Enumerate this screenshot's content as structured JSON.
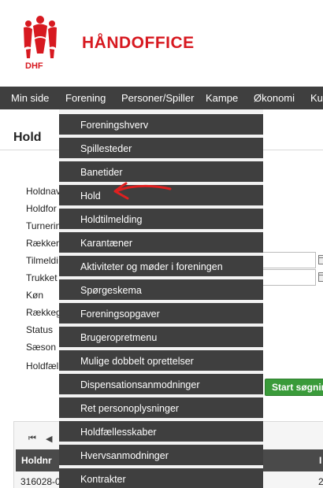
{
  "header": {
    "brand": "HÅNDOFFICE",
    "logo_caption": "DHF"
  },
  "nav": {
    "items": [
      {
        "label": "Min side"
      },
      {
        "label": "Forening"
      },
      {
        "label": "Personer/Spiller"
      },
      {
        "label": "Kampe"
      },
      {
        "label": "Økonomi"
      },
      {
        "label": "Ku"
      }
    ]
  },
  "page": {
    "title": "Hold"
  },
  "form": {
    "labels": [
      "Holdnav",
      "Holdfor",
      "Turnerin",
      "Rækken",
      "Tilmeldi",
      "Trukket",
      "Køn",
      "Rækkeg",
      "Status",
      "Sæson",
      "Holdfæl"
    ],
    "start_button": "Start søgnin"
  },
  "grid": {
    "columns": [
      "Holdnr",
      "I"
    ],
    "rows": [
      [
        "316028-0",
        "2"
      ]
    ]
  },
  "dropdown": {
    "items": [
      "Foreningshverv",
      "Spillesteder",
      "Banetider",
      "Hold",
      "Holdtilmelding",
      "Karantæner",
      "Aktiviteter og møder i foreningen",
      "Spørgeskema",
      "Foreningsopgaver",
      "Brugeropretmenu",
      "Mulige dobbelt oprettelser",
      "Dispensationsanmodninger",
      "Ret personoplysninger",
      "Holdfællesskaber",
      "Hvervsanmodninger",
      "Kontrakter"
    ]
  },
  "icons": {
    "first_page": "first-page-icon",
    "prev_page": "prev-page-icon",
    "calendar": "calendar-icon"
  },
  "colors": {
    "brand_red": "#d71920",
    "nav_bg": "#3f3f3f",
    "start_green": "#3a9b3a",
    "annotation_red": "#e02020"
  }
}
